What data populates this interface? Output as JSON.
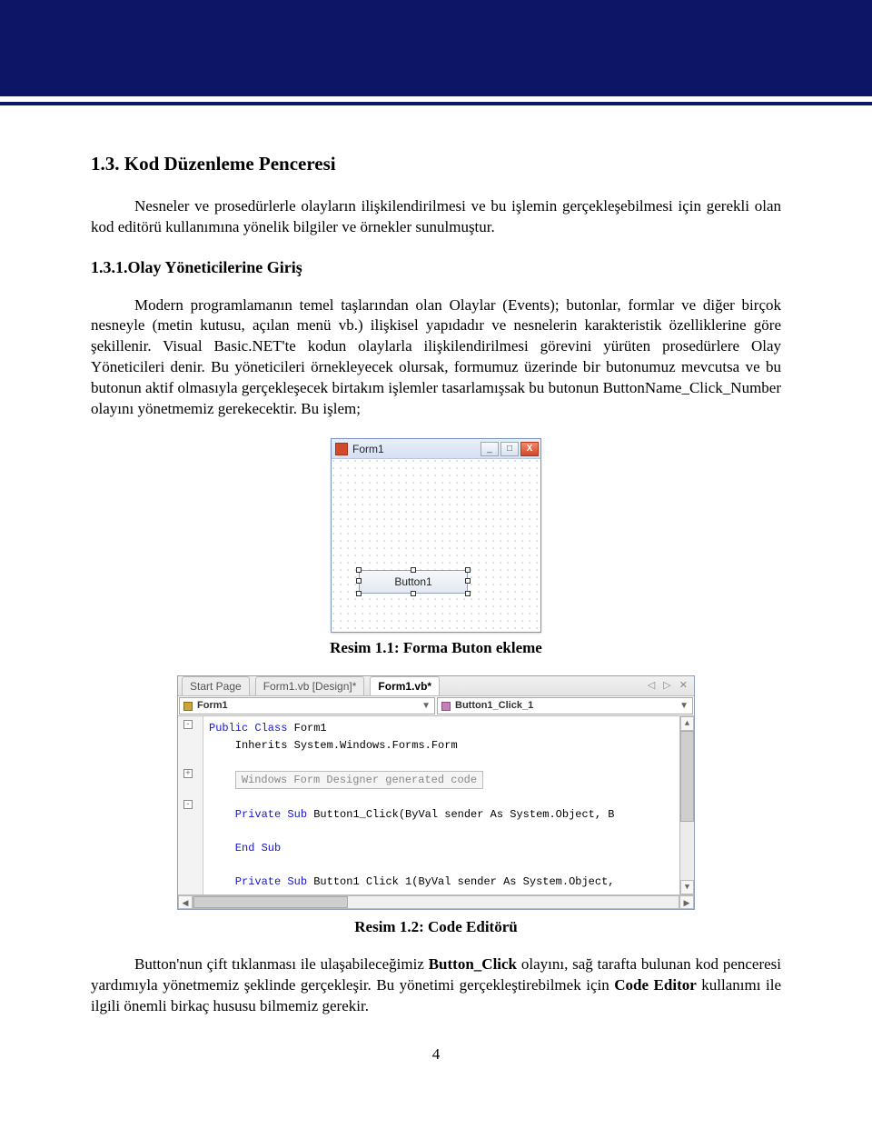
{
  "section": {
    "title": "1.3. Kod Düzenleme Penceresi",
    "intro": "Nesneler ve prosedürlerle olayların ilişkilendirilmesi ve bu işlemin gerçekleşebilmesi için gerekli olan kod editörü kullanımına yönelik bilgiler ve örnekler sunulmuştur."
  },
  "subsection": {
    "title": "1.3.1.Olay Yöneticilerine Giriş",
    "body": "Modern programlamanın temel taşlarından olan Olaylar (Events); butonlar, formlar ve diğer birçok nesneyle (metin kutusu, açılan menü vb.) ilişkisel yapıdadır ve nesnelerin karakteristik özelliklerine göre şekillenir. Visual Basic.NET'te kodun olaylarla ilişkilendirilmesi görevini yürüten prosedürlere Olay Yöneticileri denir. Bu yöneticileri örnekleyecek olursak, formumuz üzerinde bir butonumuz mevcutsa ve bu butonun aktif olmasıyla gerçekleşecek birtakım işlemler tasarlamışsak bu butonun ButtonName_Click_Number olayını yönetmemiz gerekecektir. Bu işlem;"
  },
  "figure1": {
    "caption": "Resim 1.1: Forma Buton ekleme",
    "form_title": "Form1",
    "button_label": "Button1",
    "min": "_",
    "max": "□",
    "close": "X"
  },
  "figure2": {
    "caption": "Resim 1.2: Code Editörü",
    "tabs": {
      "start": "Start Page",
      "design": "Form1.vb [Design]*",
      "code": "Form1.vb*"
    },
    "tools": "◁ ▷ ✕",
    "combo_left": "Form1",
    "combo_right": "Button1_Click_1",
    "code": {
      "l1a": "Public Class",
      "l1b": " Form1",
      "l2": "    Inherits System.Windows.Forms.Form",
      "region": "Windows Form Designer generated code",
      "l4a": "    Private Sub",
      "l4b": " Button1_Click(ByVal sender As System.Object, B",
      "l5": "    End Sub",
      "l6a": "    Private Sub",
      "l6b": " Button1 Click 1(ByVal sender As System.Object,"
    }
  },
  "closing_html": "Button'nun çift tıklanması ile ulaşabileceğimiz <b class=\"inline-bold\">Button_Click</b> olayını, sağ tarafta bulunan kod penceresi yardımıyla yönetmemiz şeklinde gerçekleşir. Bu yönetimi gerçekleştirebilmek için <b class=\"inline-bold\">Code Editor</b> kullanımı ile ilgili önemli birkaç hususu bilmemiz gerekir.",
  "page_number": "4"
}
